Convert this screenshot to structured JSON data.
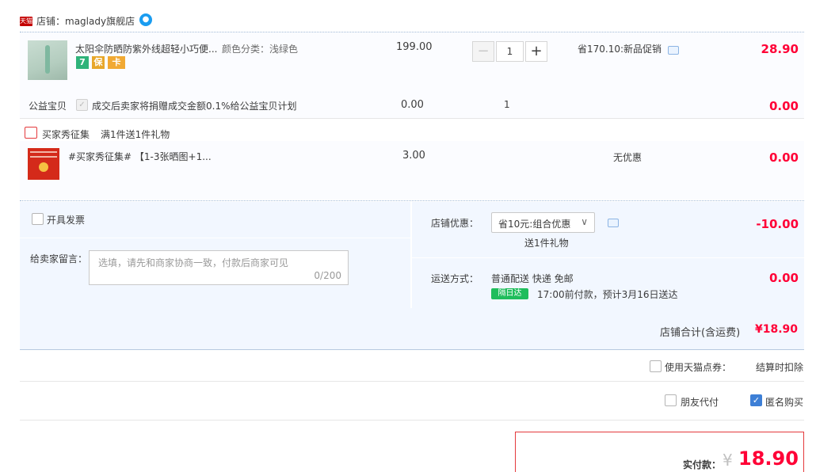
{
  "shop": {
    "badge": "天猫",
    "name": "店铺：maglady旗舰店",
    "wangwang_icon": "chat-bubble-icon"
  },
  "item1": {
    "title": "太阳伞防晒防紫外线超轻小巧便...",
    "spec": "颜色分类：浅绿色",
    "unit_price": "199.00",
    "quantity": "1",
    "promo": "省170.10:新品促销",
    "subtotal": "28.90",
    "service_icons": [
      "7",
      "保",
      "卡"
    ]
  },
  "charity": {
    "label": "公益宝贝",
    "text": "成交后卖家将捐赠成交金额0.1%给公益宝贝计划",
    "price": "0.00",
    "quantity": "1",
    "subtotal": "0.00"
  },
  "gift": {
    "label": "买家秀征集",
    "rule": "满1件送1件礼物",
    "title": "#买家秀征集# 【1-3张晒图+1...",
    "price": "3.00",
    "promo": "无优惠",
    "subtotal": "0.00"
  },
  "invoice": {
    "label": "开具发票"
  },
  "remark": {
    "label": "给卖家留言：",
    "placeholder": "选填，请先和商家协商一致，付款后商家可见",
    "counter": "0/200"
  },
  "shop_discount": {
    "label": "店铺优惠：",
    "selected": "省10元:组合优惠",
    "gift_note": "送1件礼物",
    "amount": "-10.00"
  },
  "shipping": {
    "label": "运送方式：",
    "method": "普通配送 快递 免邮",
    "badge": "隔日达",
    "eta": "17:00前付款，预计3月16日送达",
    "amount": "0.00"
  },
  "shop_total": {
    "label": "店铺合计(含运费)",
    "amount": "¥18.90"
  },
  "points": {
    "label": "使用天猫点券：",
    "note": "结算时扣除"
  },
  "options": {
    "friend_pay": "朋友代付",
    "anonymous": "匿名购买"
  },
  "payment": {
    "label": "实付款：",
    "currency": "¥",
    "amount": "18.90"
  },
  "colors": {
    "accent_red": "#ff0036",
    "band_blue": "#f2f7ff",
    "check_blue": "#3d7fd6"
  }
}
